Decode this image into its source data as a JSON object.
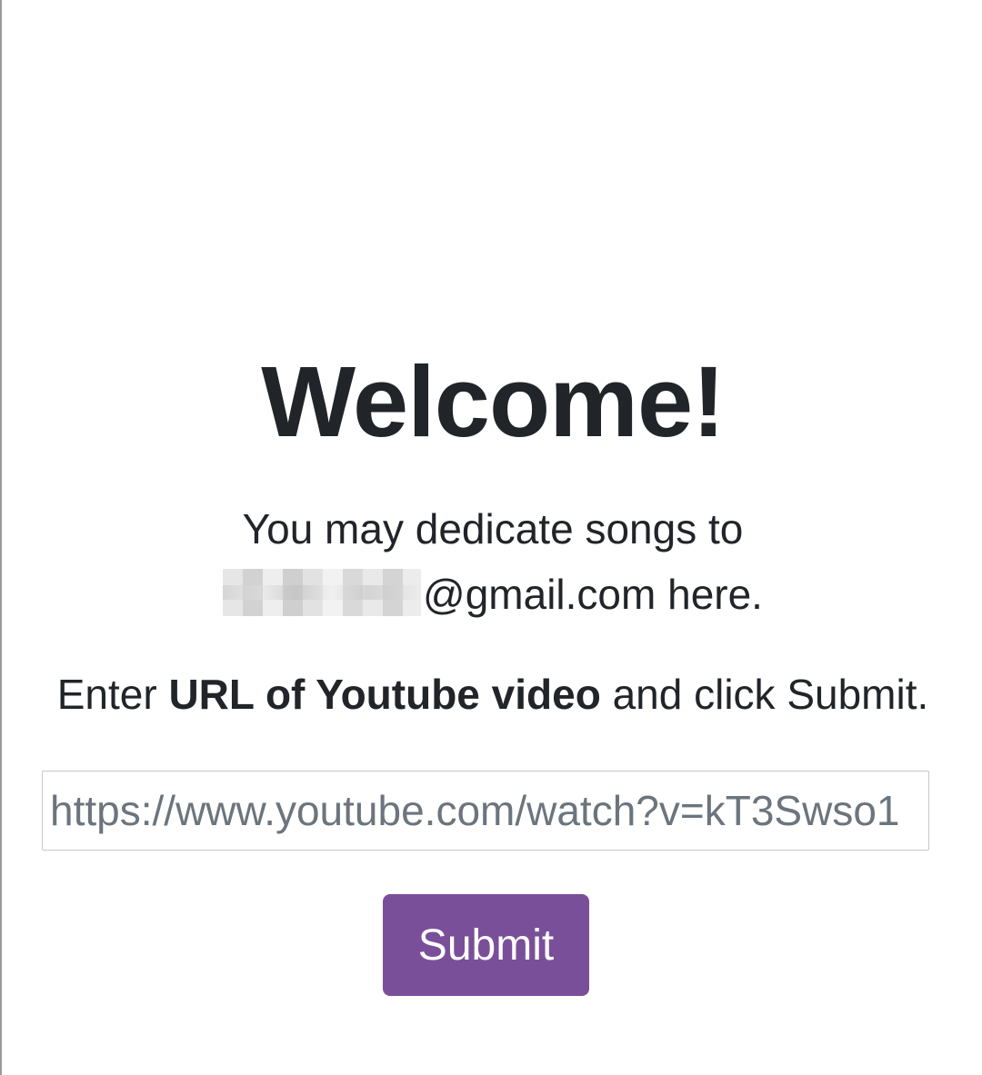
{
  "header": {
    "logo_icon": "sound-wave-icon",
    "logo_colors": [
      "#d4148f",
      "#a855c8",
      "#4a9fd8",
      "#6cc0a8",
      "#b9cf5a",
      "#e6d21e"
    ]
  },
  "main": {
    "title": "Welcome!",
    "intro_line1": "You may dedicate songs to",
    "email_suffix": "@gmail.com here.",
    "instruction": {
      "prefix": "Enter ",
      "bold": "URL of Youtube video",
      "suffix": " and click Submit."
    },
    "url_input": {
      "placeholder": "https://www.youtube.com/watch?v=kT3Swso1",
      "value": ""
    },
    "submit_label": "Submit"
  },
  "colors": {
    "text": "#212529",
    "button_bg": "#7a4f99",
    "button_text": "#ffffff",
    "input_border": "#c8c8c8",
    "placeholder": "#6c757d"
  }
}
